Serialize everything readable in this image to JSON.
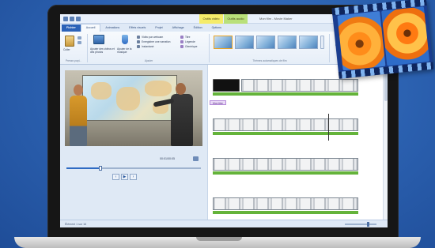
{
  "app": {
    "title": "Mon film - Movie Maker",
    "contextual_tabs": [
      "Outils vidéo",
      "Outils audio"
    ]
  },
  "tabs": [
    "Fichier",
    "Accueil",
    "Animations",
    "Effets visuels",
    "Projet",
    "Affichage",
    "Édition",
    "Options"
  ],
  "ribbon": {
    "paste_label": "Coller",
    "add_videos_label": "Ajouter des vidéos et des photos",
    "add_music_label": "Ajouter de la musique",
    "webcam_label": "Vidéo par webcam",
    "narration_label": "Enregistrer une narration",
    "snapshot_label": "Instantané",
    "title_label": "Titre",
    "caption_label": "Légende",
    "credits_label": "Générique",
    "group_clipboard": "Presse-papi...",
    "group_add": "Ajouter",
    "group_themes": "Thèmes automatiques de film",
    "group_edit": "Modifier"
  },
  "preview": {
    "time_label": "00:01/00:05",
    "progress": 0.25
  },
  "storyboard": {
    "caption_text": "Mon titre"
  },
  "status": {
    "text": "Élément 1 sur 16"
  }
}
